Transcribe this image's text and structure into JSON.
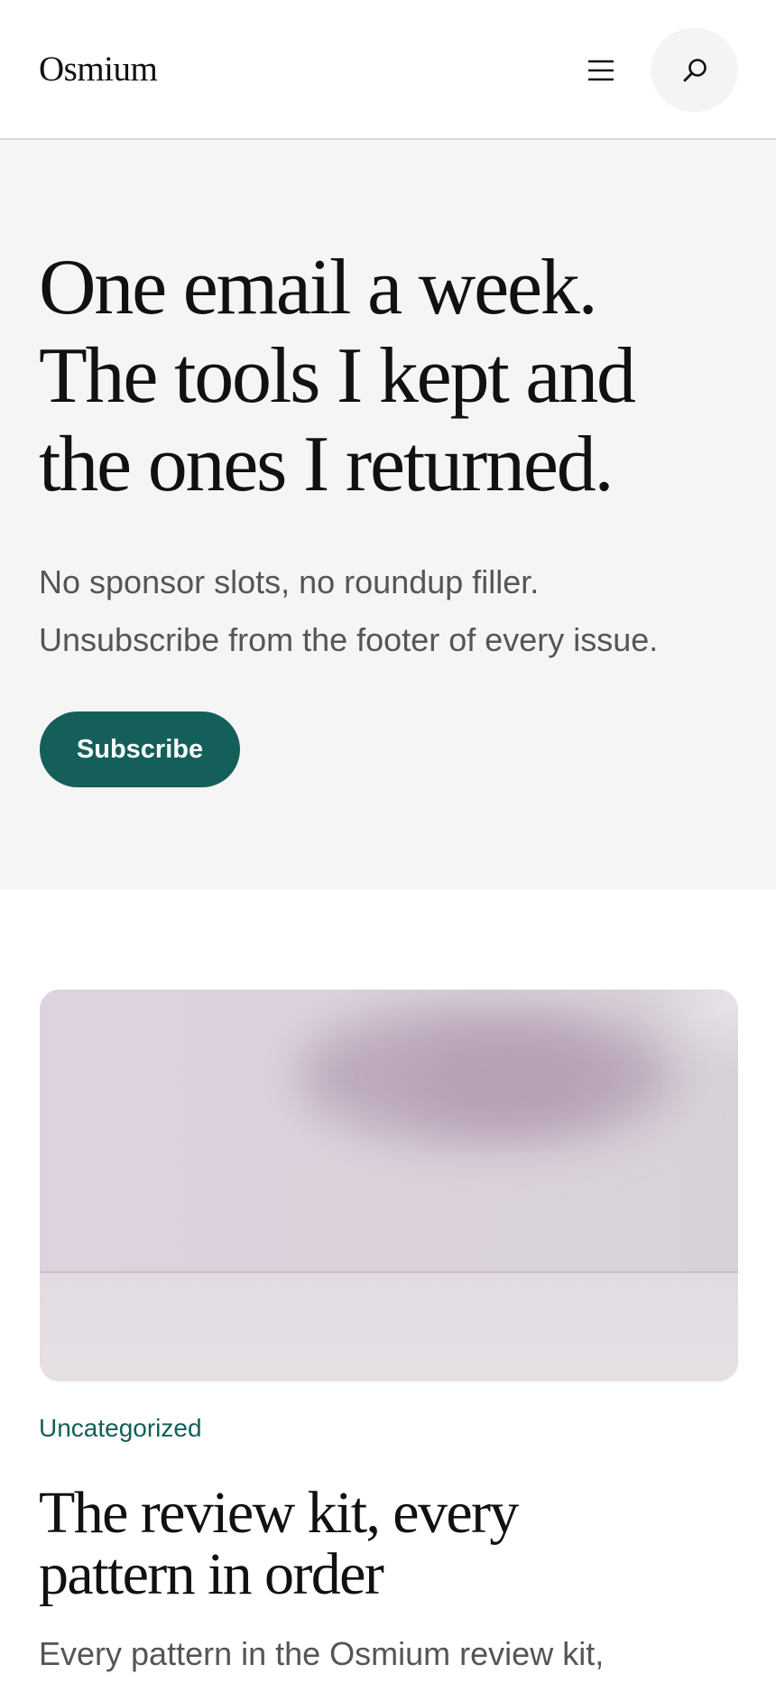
{
  "header": {
    "logo": "Osmium",
    "menu_icon": "hamburger-menu-icon",
    "search_icon": "search-icon"
  },
  "hero": {
    "title_lines": [
      "One email a week.",
      "The tools I kept and",
      "the ones I returned."
    ],
    "description_lines": [
      "No sponsor slots, no roundup filler.",
      "Unsubscribe from the footer of every issue."
    ],
    "subscribe_label": "Subscribe"
  },
  "post": {
    "category": "Uncategorized",
    "title_lines": [
      "The review kit, every",
      "pattern in order"
    ],
    "excerpt": "Every pattern in the Osmium review kit,"
  },
  "colors": {
    "accent": "#145f59",
    "hero_background": "#f5f5f6",
    "muted_text": "#555558",
    "search_button_background": "#f4f4f5"
  }
}
